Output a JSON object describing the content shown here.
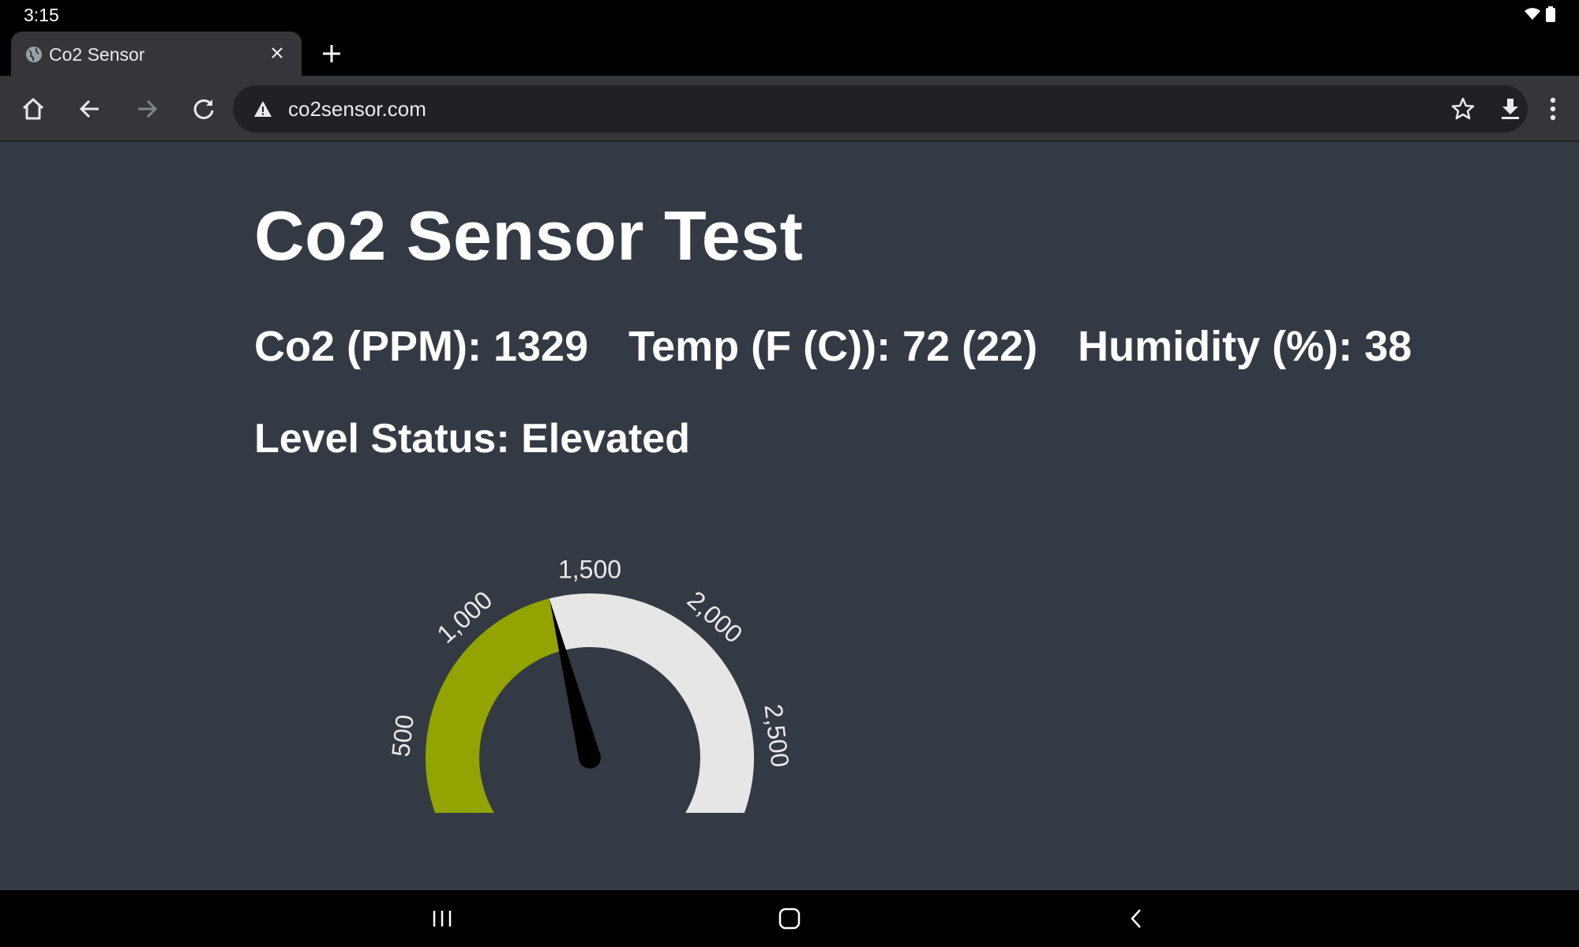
{
  "status_bar": {
    "time": "3:15"
  },
  "tab": {
    "title": "Co2 Sensor"
  },
  "omnibox": {
    "url": "co2sensor.com"
  },
  "page": {
    "title": "Co2 Sensor Test",
    "readings": [
      "Co2 (PPM): 1329",
      "Temp (F (C)): 72 (22)",
      "Humidity (%): 38"
    ],
    "level_status": "Level Status: Elevated"
  },
  "gauge": {
    "value": 1329,
    "min": 0,
    "max": 3000,
    "ticks": [
      "500",
      "1,000",
      "1,500",
      "2,000",
      "2,500"
    ],
    "fill_color": "#93a301",
    "track_color": "#e6e6e6",
    "needle_color": "#000000"
  }
}
